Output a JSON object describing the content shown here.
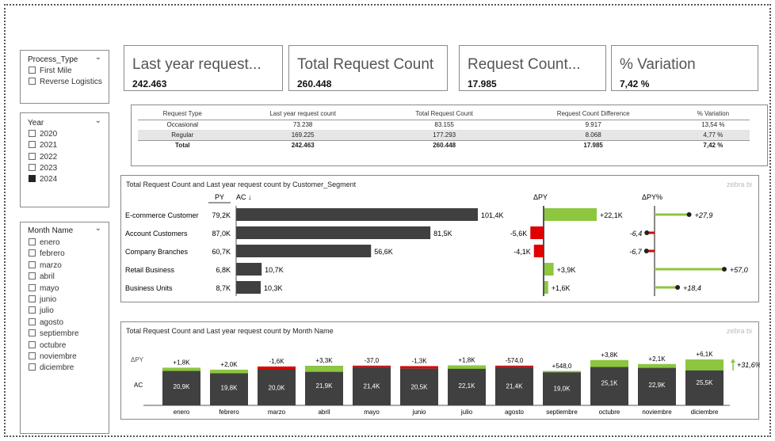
{
  "slicers": {
    "process_type": {
      "title": "Process_Type",
      "items": [
        {
          "label": "First Mile",
          "checked": false
        },
        {
          "label": "Reverse Logistics",
          "checked": false
        }
      ]
    },
    "year": {
      "title": "Year",
      "items": [
        {
          "label": "2020",
          "checked": false
        },
        {
          "label": "2021",
          "checked": false
        },
        {
          "label": "2022",
          "checked": false
        },
        {
          "label": "2023",
          "checked": false
        },
        {
          "label": "2024",
          "checked": true
        }
      ]
    },
    "month": {
      "title": "Month Name",
      "items": [
        {
          "label": "enero"
        },
        {
          "label": "febrero"
        },
        {
          "label": "marzo"
        },
        {
          "label": "abril"
        },
        {
          "label": "mayo"
        },
        {
          "label": "junio"
        },
        {
          "label": "julio"
        },
        {
          "label": "agosto"
        },
        {
          "label": "septiembre"
        },
        {
          "label": "octubre"
        },
        {
          "label": "noviembre"
        },
        {
          "label": "diciembre"
        }
      ]
    }
  },
  "cards": [
    {
      "label": "Last year request...",
      "value": "242.463"
    },
    {
      "label": "Total Request Count",
      "value": "260.448"
    },
    {
      "label": "Request Count...",
      "value": "17.985"
    },
    {
      "label": "% Variation",
      "value": "7,42 %"
    }
  ],
  "matrix": {
    "headers": [
      "Request Type",
      "Last year request count",
      "Total Request Count",
      "Request Count Difference",
      "% Variation"
    ],
    "rows": [
      [
        "Occasional",
        "73.238",
        "83.155",
        "9.917",
        "13,54 %"
      ],
      [
        "Regular",
        "169.225",
        "177.293",
        "8.068",
        "4,77 %"
      ]
    ],
    "total": [
      "Total",
      "242.463",
      "260.448",
      "17.985",
      "7,42 %"
    ]
  },
  "segment_visual": {
    "title": "Total Request Count and Last year request count by Customer_Segment",
    "watermark": "zebra bi",
    "col_py": "PY",
    "col_ac": "AC ↓",
    "col_dpy": "ΔPY",
    "col_dpypct": "ΔPY%",
    "colors": {
      "bar": "#404040",
      "positive": "#8dc63f",
      "negative": "#e00000"
    }
  },
  "month_visual": {
    "title": "Total Request Count and Last year request count by Month Name",
    "watermark": "zebra bi",
    "row_dpy": "ΔPY",
    "row_ac": "AC",
    "total_pct": "+31,6%"
  },
  "chart_data": [
    {
      "type": "bar",
      "title": "Total Request Count and Last year request count by Customer_Segment",
      "categories": [
        "E-commerce Customer",
        "Account Customers",
        "Company Branches",
        "Retail Business",
        "Business Units"
      ],
      "py_labels": [
        "79,2K",
        "87,0K",
        "60,7K",
        "6,8K",
        "8,7K"
      ],
      "ac_labels": [
        "101,4K",
        "81,5K",
        "56,6K",
        "10,7K",
        "10,3K"
      ],
      "dpy_labels": [
        "+22,1K",
        "-5,6K",
        "-4,1K",
        "+3,9K",
        "+1,6K"
      ],
      "dpypct_labels": [
        "+27,9",
        "-6,4",
        "-6,7",
        "+57,0",
        "+18,4"
      ],
      "series": [
        {
          "name": "PY",
          "values": [
            79.2,
            87.0,
            60.7,
            6.8,
            8.7
          ]
        },
        {
          "name": "AC",
          "values": [
            101.4,
            81.5,
            56.6,
            10.7,
            10.3
          ]
        },
        {
          "name": "ΔPY",
          "values": [
            22.1,
            -5.6,
            -4.1,
            3.9,
            1.6
          ]
        },
        {
          "name": "ΔPY%",
          "values": [
            27.9,
            -6.4,
            -6.7,
            57.0,
            18.4
          ]
        }
      ]
    },
    {
      "type": "bar",
      "title": "Total Request Count and Last year request count by Month Name",
      "categories": [
        "enero",
        "febrero",
        "marzo",
        "abril",
        "mayo",
        "junio",
        "julio",
        "agosto",
        "septiembre",
        "octubre",
        "noviembre",
        "diciembre"
      ],
      "ac_labels": [
        "20,9K",
        "19,8K",
        "20,0K",
        "21,9K",
        "21,4K",
        "20,5K",
        "22,1K",
        "21,4K",
        "19,0K",
        "25,1K",
        "22,9K",
        "25,5K"
      ],
      "dpy_labels": [
        "+1,8K",
        "+2,0K",
        "-1,6K",
        "+3,3K",
        "-37,0",
        "-1,3K",
        "+1,8K",
        "-574,0",
        "+548,0",
        "+3,8K",
        "+2,1K",
        "+6,1K"
      ],
      "series": [
        {
          "name": "AC",
          "values": [
            20.9,
            19.8,
            20.0,
            21.9,
            21.4,
            20.5,
            22.1,
            21.4,
            19.0,
            25.1,
            22.9,
            25.5
          ]
        },
        {
          "name": "ΔPY",
          "values": [
            1.8,
            2.0,
            -1.6,
            3.3,
            -0.037,
            -1.3,
            1.8,
            -0.574,
            0.548,
            3.8,
            2.1,
            6.1
          ]
        }
      ]
    }
  ]
}
